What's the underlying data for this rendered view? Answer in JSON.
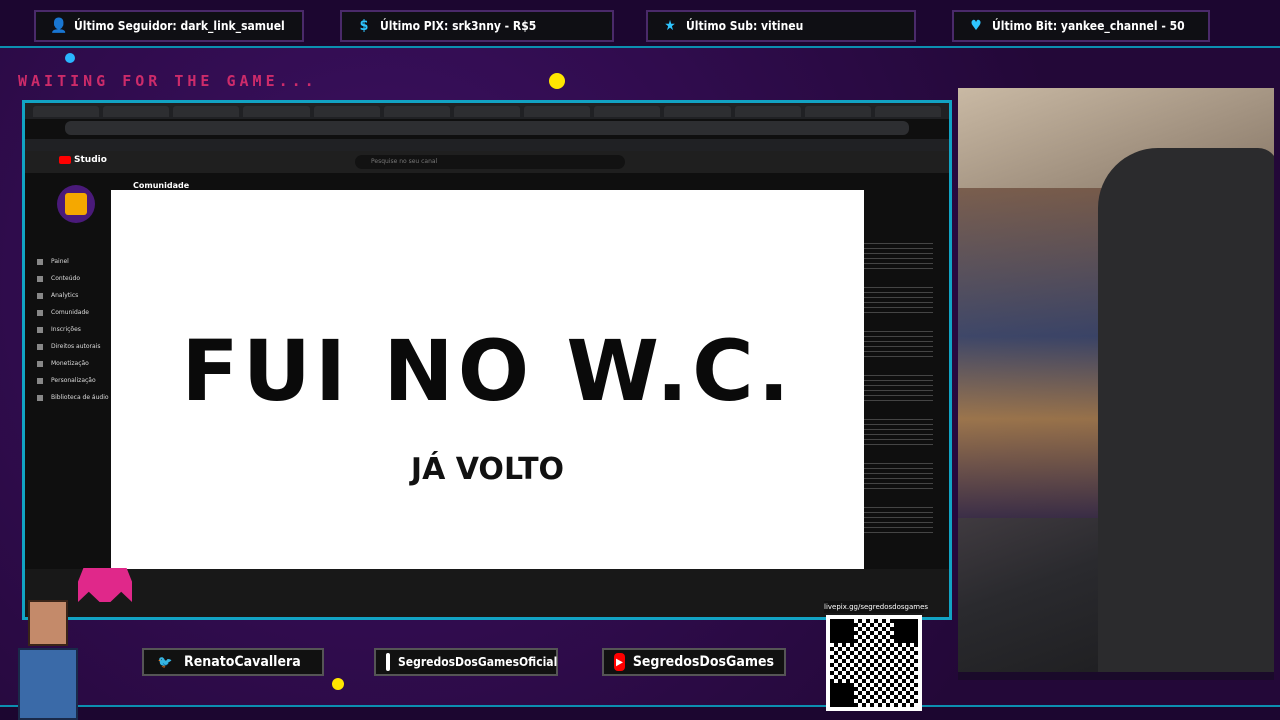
{
  "alerts": {
    "follower": "Último Seguidor: dark_link_samuel",
    "pix": "Último PIX: srk3nny - R$5",
    "sub": "Último Sub: vitineu",
    "bit": "Último Bit: yankee_channel - 50"
  },
  "waiting_text": "WAITING FOR THE GAME...",
  "browser": {
    "studio_label": "Studio",
    "search_placeholder": "Pesquise no seu canal",
    "section_title": "Comunidade",
    "sidebar": [
      "Painel",
      "Conteúdo",
      "Analytics",
      "Comunidade",
      "Inscrições",
      "Direitos autorais",
      "Monetização",
      "Personalização",
      "Biblioteca de áudio"
    ]
  },
  "card": {
    "title": "FUI NO W.C.",
    "subtitle": "JÁ VOLTO"
  },
  "socials": {
    "twitter": "RenatoCavallera",
    "instagram": "SegredosDosGamesOficial",
    "youtube": "SegredosDosGames"
  },
  "qr_label": "livepix.gg/segredosdosgames",
  "colors": {
    "frame": "#12a3c4",
    "background": "#2a0a45",
    "accent_pink": "#e8316f",
    "accent_yellow": "#ffe600"
  }
}
